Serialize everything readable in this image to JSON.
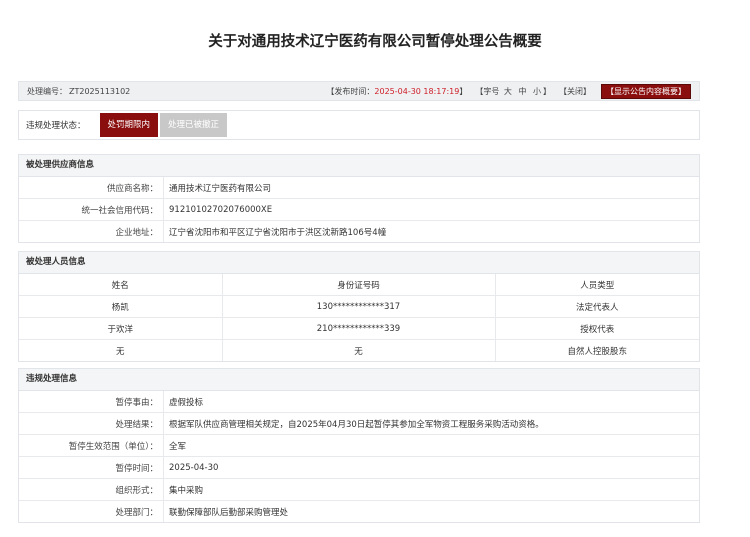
{
  "title": "关于对通用技术辽宁医药有限公司暂停处理公告概要",
  "meta": {
    "record_label": "处理编号：",
    "record_no": "ZT2025113102",
    "publish_label": "【发布时间：",
    "publish_time": "2025-04-30 18:17:19",
    "publish_close": "】",
    "font_label": "【字号",
    "font_large": "大",
    "font_medium": "中",
    "font_small": "小",
    "font_close": "】",
    "close_link": "【关闭】",
    "summary_button": "【显示公告内容概要】"
  },
  "status": {
    "label": "违规处理状态：",
    "active_button": "处罚期限内",
    "inactive_button": "处理已被撤正"
  },
  "supplier": {
    "heading": "被处理供应商信息",
    "rows": [
      {
        "label": "供应商名称：",
        "value": "通用技术辽宁医药有限公司"
      },
      {
        "label": "统一社会信用代码：",
        "value": "91210102702076000XE"
      },
      {
        "label": "企业地址：",
        "value": "辽宁省沈阳市和平区辽宁省沈阳市于洪区沈新路106号4幢"
      }
    ]
  },
  "persons": {
    "heading": "被处理人员信息",
    "columns": [
      "姓名",
      "身份证号码",
      "人员类型"
    ],
    "rows": [
      [
        "杨凯",
        "130************317",
        "法定代表人"
      ],
      [
        "于欢洋",
        "210************339",
        "授权代表"
      ],
      [
        "无",
        "无",
        "自然人控股股东"
      ]
    ]
  },
  "violation": {
    "heading": "违规处理信息",
    "rows": [
      {
        "label": "暂停事由：",
        "value": "虚假投标"
      },
      {
        "label": "处理结果：",
        "value": "根据军队供应商管理相关规定，自2025年04月30日起暂停其参加全军物资工程服务采购活动资格。"
      },
      {
        "label": "暂停生效范围（单位）：",
        "value": "全军"
      },
      {
        "label": "暂停时间：",
        "value": "2025-04-30"
      },
      {
        "label": "组织形式：",
        "value": "集中采购"
      },
      {
        "label": "处理部门：",
        "value": "联勤保障部队后勤部采购管理处"
      }
    ]
  },
  "colors": {
    "accent": "#8a0e0e",
    "highlight": "#d0202a",
    "inactive": "#c8c8c8"
  }
}
